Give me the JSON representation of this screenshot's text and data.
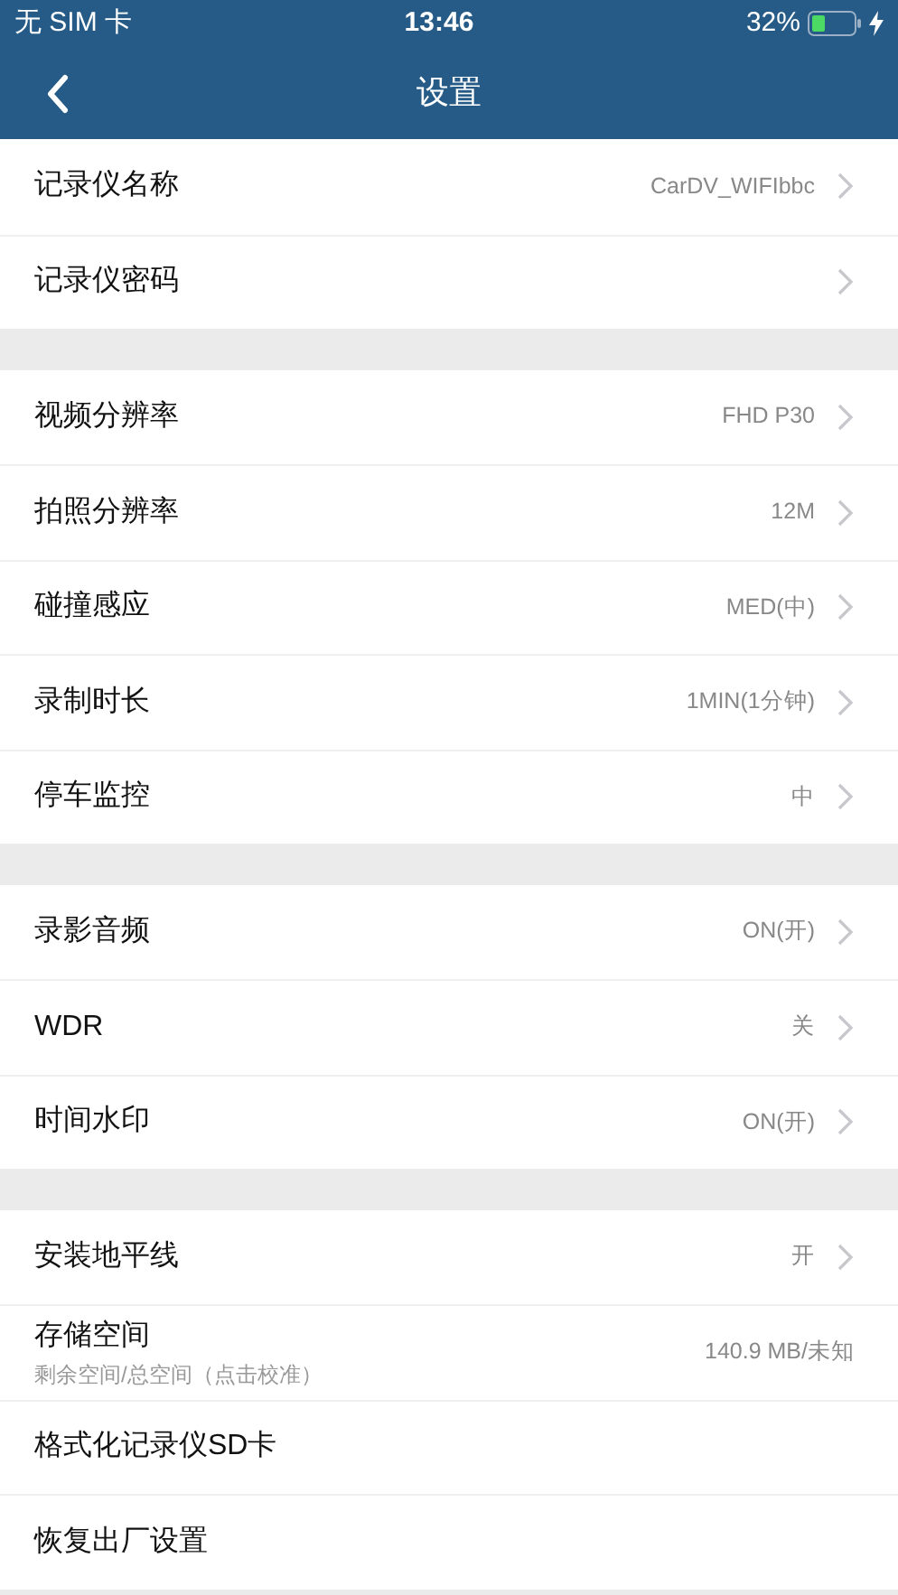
{
  "status_bar": {
    "carrier": "无 SIM 卡",
    "time": "13:46",
    "battery": "32%"
  },
  "nav": {
    "title": "设置"
  },
  "groups": [
    {
      "rows": [
        {
          "label": "记录仪名称",
          "value": "CarDV_WIFIbbc",
          "chevron": true
        },
        {
          "label": "记录仪密码",
          "chevron": true
        }
      ]
    },
    {
      "rows": [
        {
          "label": "视频分辨率",
          "value": "FHD P30",
          "chevron": true
        },
        {
          "label": "拍照分辨率",
          "value": "12M",
          "chevron": true
        },
        {
          "label": "碰撞感应",
          "value": "MED(中)",
          "chevron": true
        },
        {
          "label": "录制时长",
          "value": "1MIN(1分钟)",
          "chevron": true
        },
        {
          "label": "停车监控",
          "value": "中",
          "chevron": true
        }
      ]
    },
    {
      "rows": [
        {
          "label": "录影音频",
          "value": "ON(开)",
          "chevron": true
        },
        {
          "label": "WDR",
          "value": "关",
          "chevron": true
        },
        {
          "label": "时间水印",
          "value": "ON(开)",
          "chevron": true
        }
      ]
    },
    {
      "rows": [
        {
          "label": "安装地平线",
          "value": "开",
          "chevron": true
        },
        {
          "label": "存储空间",
          "sublabel": "剩余空间/总空间（点击校准）",
          "value": "140.9 MB/未知",
          "chevron": false
        },
        {
          "label": "格式化记录仪SD卡",
          "chevron": false
        },
        {
          "label": "恢复出厂设置",
          "chevron": false
        }
      ]
    }
  ]
}
